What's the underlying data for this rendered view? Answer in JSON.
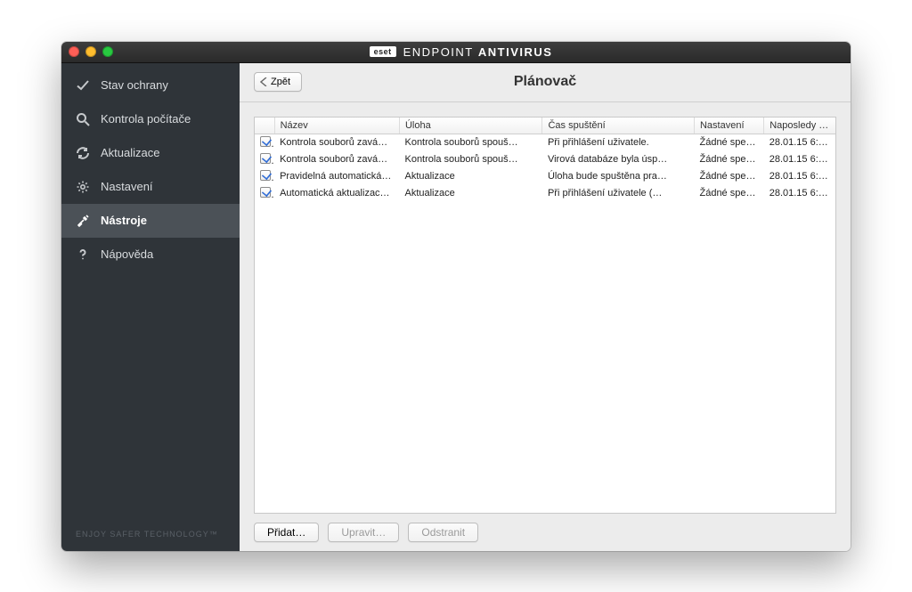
{
  "titlebar": {
    "logo": "eset",
    "title_thin": "ENDPOINT",
    "title_bold": "ANTIVIRUS"
  },
  "sidebar": {
    "items": [
      {
        "label": "Stav ochrany",
        "icon": "check-icon"
      },
      {
        "label": "Kontrola počítače",
        "icon": "search-icon"
      },
      {
        "label": "Aktualizace",
        "icon": "refresh-icon"
      },
      {
        "label": "Nastavení",
        "icon": "gear-icon"
      },
      {
        "label": "Nástroje",
        "icon": "tools-icon"
      },
      {
        "label": "Nápověda",
        "icon": "help-icon"
      }
    ],
    "active_index": 4,
    "footer": "ENJOY SAFER TECHNOLOGY™"
  },
  "toolbar": {
    "back_label": "Zpět",
    "page_title": "Plánovač"
  },
  "table": {
    "columns": [
      "Název",
      "Úloha",
      "Čas spuštění",
      "Nastavení",
      "Naposledy s…"
    ],
    "rows": [
      {
        "checked": true,
        "name": "Kontrola souborů zavá…",
        "task": "Kontrola souborů spouš…",
        "time": "Při přihlášení uživatele.",
        "settings": "Žádné speci…",
        "last": "28.01.15 6:…"
      },
      {
        "checked": true,
        "name": "Kontrola souborů zavá…",
        "task": "Kontrola souborů spouš…",
        "time": "Virová databáze byla úsp…",
        "settings": "Žádné speci…",
        "last": "28.01.15 6:…"
      },
      {
        "checked": true,
        "name": "Pravidelná automatická…",
        "task": "Aktualizace",
        "time": "Úloha bude spuštěna pra…",
        "settings": "Žádné speci…",
        "last": "28.01.15 6:…"
      },
      {
        "checked": true,
        "name": "Automatická aktualizac…",
        "task": "Aktualizace",
        "time": "Při přihlášení uživatele (…",
        "settings": "Žádné speci…",
        "last": "28.01.15 6:…"
      }
    ]
  },
  "actions": {
    "add": "Přidat…",
    "edit": "Upravit…",
    "remove": "Odstranit"
  }
}
